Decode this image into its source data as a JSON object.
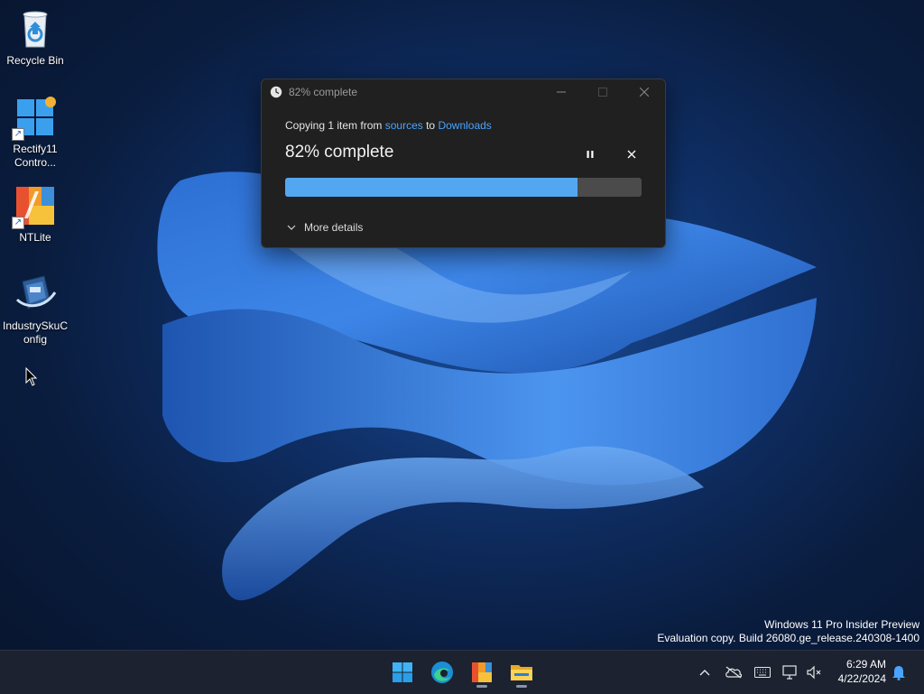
{
  "desktop": {
    "icons": [
      {
        "label": "Recycle Bin",
        "icon": "recycle-bin-icon"
      },
      {
        "label": "Rectify11 Contro...",
        "icon": "rectify11-control-icon"
      },
      {
        "label": "NTLite",
        "icon": "ntlite-icon"
      },
      {
        "label": "IndustrySkuConfig",
        "icon": "industry-sku-config-icon"
      }
    ]
  },
  "copy_dialog": {
    "window_title": "82% complete",
    "prefix": "Copying 1 item from ",
    "source": "sources",
    "middle": " to ",
    "destination": "Downloads",
    "status": "82% complete",
    "progress_percent": 82,
    "more_details": "More details",
    "accent_color": "#53a7f0"
  },
  "watermark": {
    "line1": "Windows 11 Pro Insider Preview",
    "line2": "Evaluation copy. Build 26080.ge_release.240308-1400"
  },
  "taskbar": {
    "apps": [
      "start-icon",
      "edge-icon",
      "ntlite-icon",
      "file-explorer-icon"
    ],
    "tray_icons": [
      "chevron-up-icon",
      "onedrive-offline-icon",
      "keyboard-icon",
      "network-icon",
      "volume-muted-icon",
      "notification-bell-icon"
    ],
    "time": "6:29 AM",
    "date": "4/22/2024"
  }
}
